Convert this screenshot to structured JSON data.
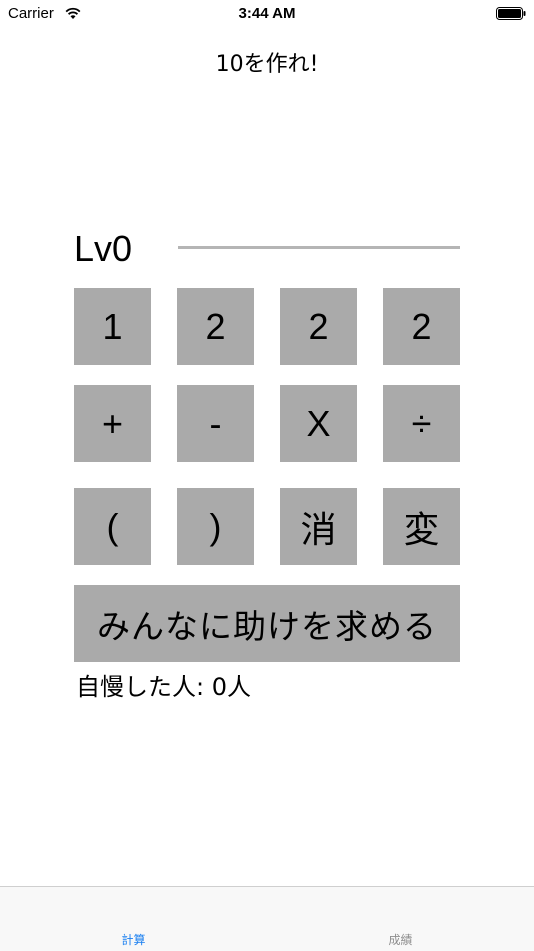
{
  "status_bar": {
    "carrier": "Carrier",
    "time": "3:44 AM",
    "wifi_icon": "wifi-icon",
    "battery_icon": "battery-icon"
  },
  "nav": {
    "title": "10を作れ!"
  },
  "game": {
    "level": "Lv0",
    "numbers": [
      "1",
      "2",
      "2",
      "2"
    ],
    "operators": [
      "+",
      "-",
      "X",
      "÷"
    ],
    "controls": [
      "(",
      ")",
      "消",
      "変"
    ],
    "help_button": "みんなに助けを求める",
    "boast_count": "自慢した人:  0人"
  },
  "tab_bar": {
    "tabs": [
      {
        "label": "計算",
        "active": true
      },
      {
        "label": "成績",
        "active": false
      }
    ],
    "active_color": "#1a7ff0",
    "inactive_color": "#8e8e8e"
  },
  "colors": {
    "key_background": "#aaaaaa",
    "answer_line": "#b5b5b5"
  }
}
